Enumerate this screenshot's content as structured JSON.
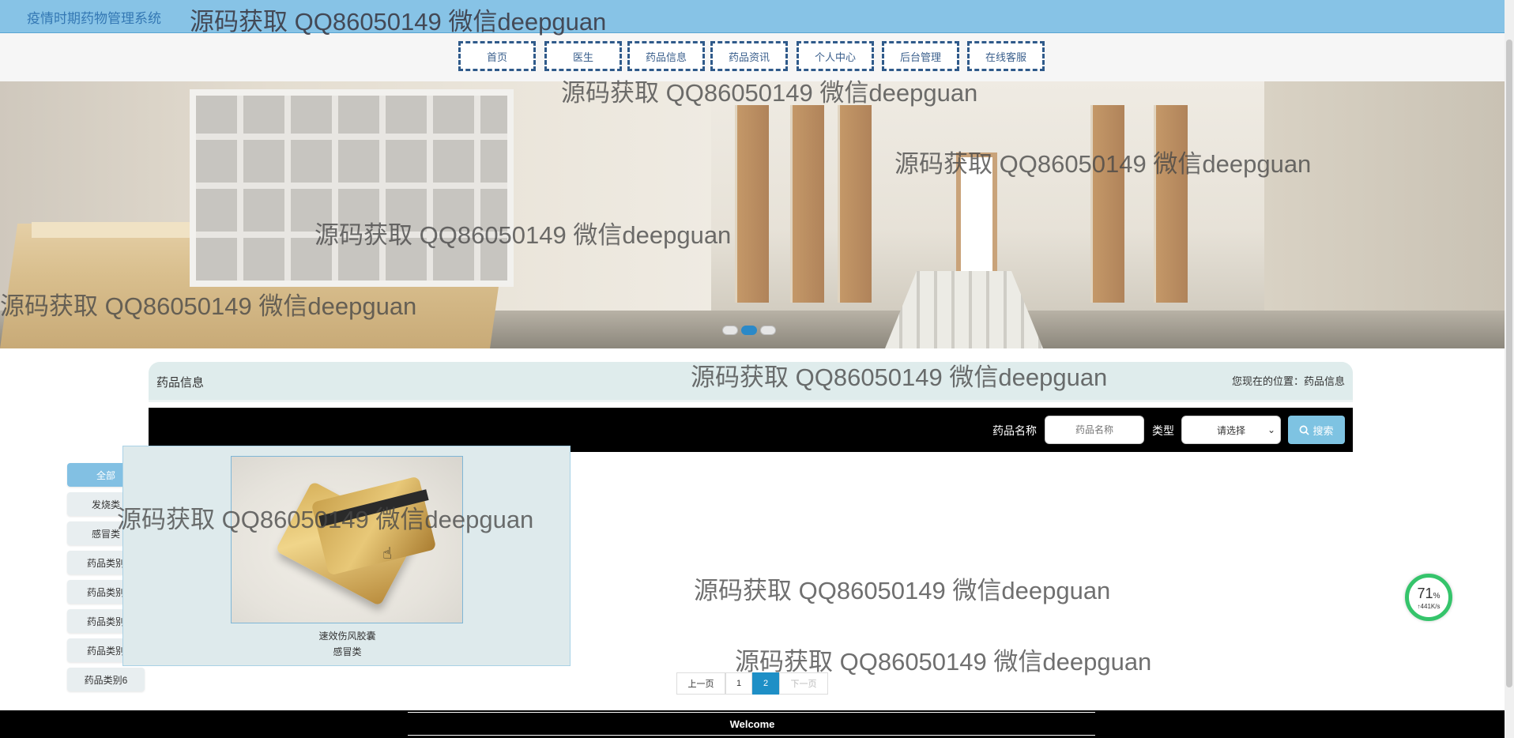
{
  "header": {
    "app_title": "疫情时期药物管理系统",
    "watermark": "源码获取 QQ86050149 微信deepguan"
  },
  "nav": {
    "items": [
      {
        "label": "首页"
      },
      {
        "label": "医生"
      },
      {
        "label": "药品信息"
      },
      {
        "label": "药品资讯"
      },
      {
        "label": "个人中心"
      },
      {
        "label": "后台管理"
      },
      {
        "label": "在线客服"
      }
    ]
  },
  "carousel": {
    "slide_count": 3,
    "active_index": 1
  },
  "section": {
    "title": "药品信息",
    "location_label": "您现在的位置：",
    "location_value": "药品信息"
  },
  "search": {
    "name_label": "药品名称",
    "name_placeholder": "药品名称",
    "type_label": "类型",
    "type_selected": "请选择",
    "button_label": "搜索",
    "accent_color": "#7ec3e2"
  },
  "sidebar": {
    "categories": [
      {
        "label": "全部",
        "active": true
      },
      {
        "label": "发烧类"
      },
      {
        "label": "感冒类"
      },
      {
        "label": "药品类别"
      },
      {
        "label": "药品类别"
      },
      {
        "label": "药品类别"
      },
      {
        "label": "药品类别"
      },
      {
        "label": "药品类别6"
      }
    ]
  },
  "products": [
    {
      "name": "速效伤风胶囊",
      "category": "感冒类"
    }
  ],
  "pagination": {
    "prev": "上一页",
    "pages": [
      "1",
      "2"
    ],
    "current": "2",
    "next": "下一页"
  },
  "footer": {
    "text": "Welcome"
  },
  "speed_widget": {
    "percent": "71",
    "percent_unit": "%",
    "rate": "↑441K/s"
  }
}
